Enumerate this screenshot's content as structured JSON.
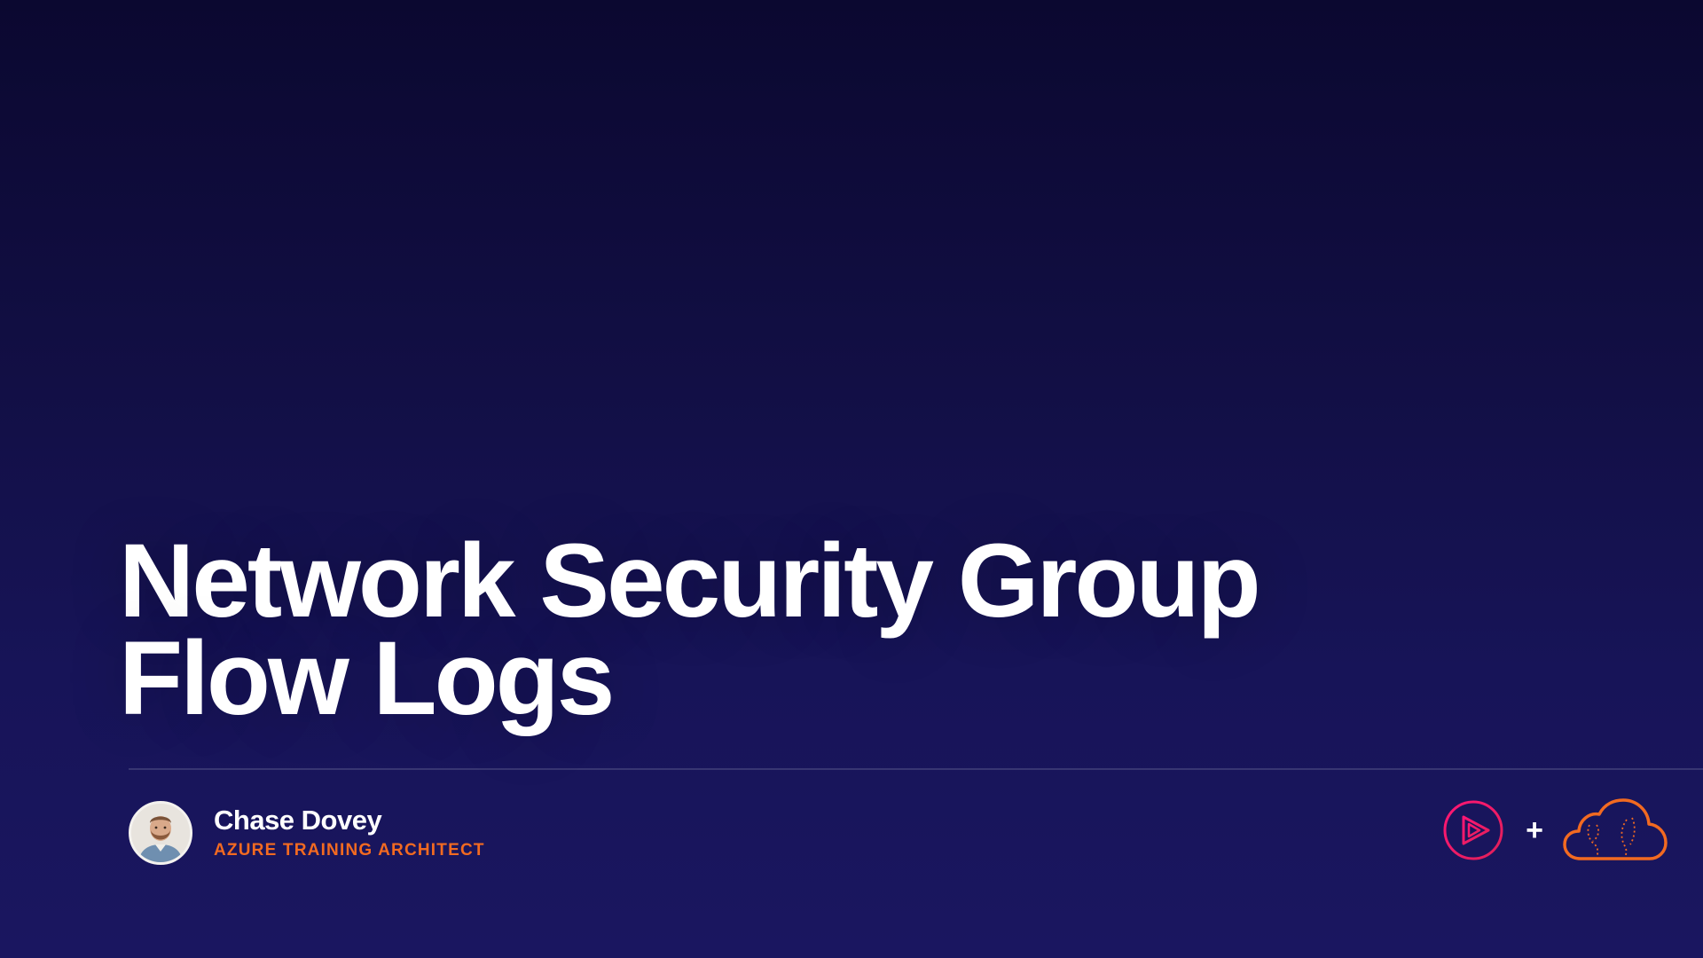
{
  "slide": {
    "title_lines": [
      "Network Security Group",
      "Flow Logs"
    ]
  },
  "presenter": {
    "name": "Chase Dovey",
    "role": "AZURE TRAINING ARCHITECT"
  },
  "logos": {
    "separator": "+",
    "left_icon": "play-triangle-icon",
    "right_icon": "cloud-icon"
  },
  "colors": {
    "background_top": "#0b0830",
    "background_bottom": "#1a1660",
    "accent_orange": "#f26a21",
    "accent_pink": "#e0205a"
  }
}
